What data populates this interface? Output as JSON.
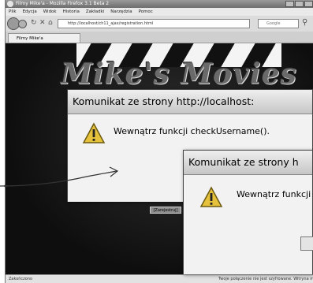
{
  "browser": {
    "title": "Filmy Mike'a - Mozilla Firefox 3.1 Beta 2",
    "menu": [
      "Plik",
      "Edycja",
      "Widok",
      "Historia",
      "Zakładki",
      "Narzędzia",
      "Pomoc"
    ],
    "url": "http://localhost/ch11_ajax/registration.html",
    "search_placeholder": "Google",
    "tab_title": "Filmy Mike'a",
    "status_left": "Zakończono",
    "status_right": "Twoje połączenie nie jest szyfrowane. Witryna może ..."
  },
  "page": {
    "logo_text": "Mike's Movies",
    "submit_label": "[Zarejestruj]"
  },
  "dialog_front": {
    "title": "Komunikat ze strony http://localhost:",
    "message": "Wewnątrz funkcji checkUsername()."
  },
  "dialog_back": {
    "title": "Komunikat ze strony h",
    "message": "Wewnątrz funkcji"
  },
  "colors": {
    "page_background": "#151515",
    "dialog_background": "#f0f0f0"
  }
}
